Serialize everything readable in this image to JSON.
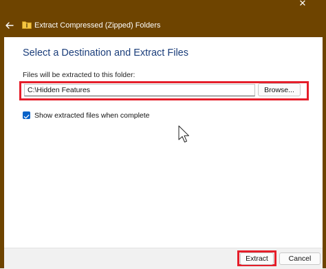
{
  "window": {
    "title": "Extract Compressed (Zipped) Folders",
    "frame_color": "#6e4400",
    "close_icon": "close-icon",
    "back_icon": "back-arrow-icon",
    "folder_icon": "zip-folder-icon"
  },
  "dialog": {
    "heading": "Select a Destination and Extract Files",
    "destination_label": "Files will be extracted to this folder:",
    "destination_value": "C:\\Hidden Features",
    "browse_label": "Browse...",
    "show_files_label": "Show extracted files when complete",
    "show_files_checked": true
  },
  "footer": {
    "extract_label": "Extract",
    "cancel_label": "Cancel"
  },
  "colors": {
    "accent": "#0a63c9",
    "heading": "#1a3d7a",
    "highlight": "#e51e2a"
  }
}
